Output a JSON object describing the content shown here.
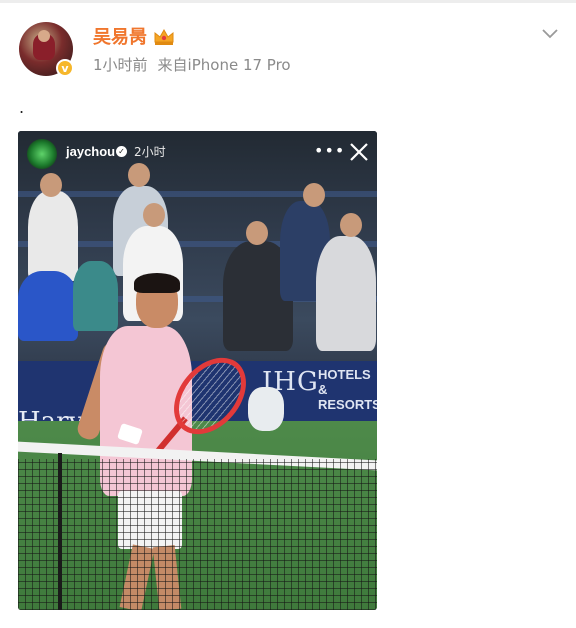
{
  "post": {
    "username": "吴易昺",
    "time": "1小时前",
    "source": "来自iPhone 17 Pro",
    "text": "."
  },
  "story": {
    "username": "jaychou",
    "time": "2小时"
  },
  "scene": {
    "banner_brand": "IHG",
    "banner_line1": "HOTELS &",
    "banner_line2": "RESORTS",
    "banner_left": "Harvey"
  },
  "colors": {
    "username": "#f0762d",
    "meta": "#8a8a8a",
    "verified_badge": "#f6b72b"
  },
  "icons": {
    "verified": "verified-badge-icon",
    "crown": "crown-icon",
    "menu": "chevron-down-icon",
    "more": "more-dots-icon",
    "close": "close-icon"
  }
}
